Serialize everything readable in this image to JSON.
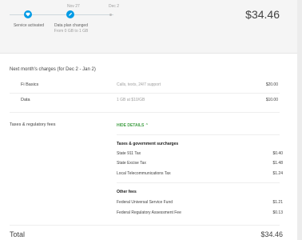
{
  "timeline": {
    "dates": [
      "Nov 27",
      "Dec 2"
    ],
    "events": [
      {
        "label": "Service activated",
        "icon": "heart-icon"
      },
      {
        "label": "Data plan changed",
        "sub": "From 0 GB to 1 GB",
        "icon": "pencil-icon"
      }
    ]
  },
  "header": {
    "amount": "$34.46"
  },
  "charges": {
    "title": "Next month's charges (for Dec 2 - Jan 2)",
    "rows": [
      {
        "name": "Fi Basics",
        "desc": "Calls, texts, 24/7 support",
        "amount": "$20.00"
      },
      {
        "name": "Data",
        "desc": "1 GB at $10/GB",
        "amount": "$10.00"
      }
    ]
  },
  "taxes": {
    "label": "Taxes & regulatory fees",
    "hide_link": "HIDE DETAILS",
    "groups": [
      {
        "title": "Taxes & government surcharges",
        "items": [
          {
            "name": "State 911 Tax",
            "amount": "$0.40"
          },
          {
            "name": "State Excise Tax",
            "amount": "$1.48"
          },
          {
            "name": "Local Telecommunications Tax",
            "amount": "$1.24"
          }
        ]
      },
      {
        "title": "Other fees",
        "items": [
          {
            "name": "Federal Universal Service Fund",
            "amount": "$1.21"
          },
          {
            "name": "Federal Regulatory Assessment Fee",
            "amount": "$0.13"
          }
        ]
      }
    ]
  },
  "total": {
    "label": "Total",
    "amount": "$34.46"
  },
  "colors": {
    "accent": "#039be5",
    "link": "#43a047"
  }
}
